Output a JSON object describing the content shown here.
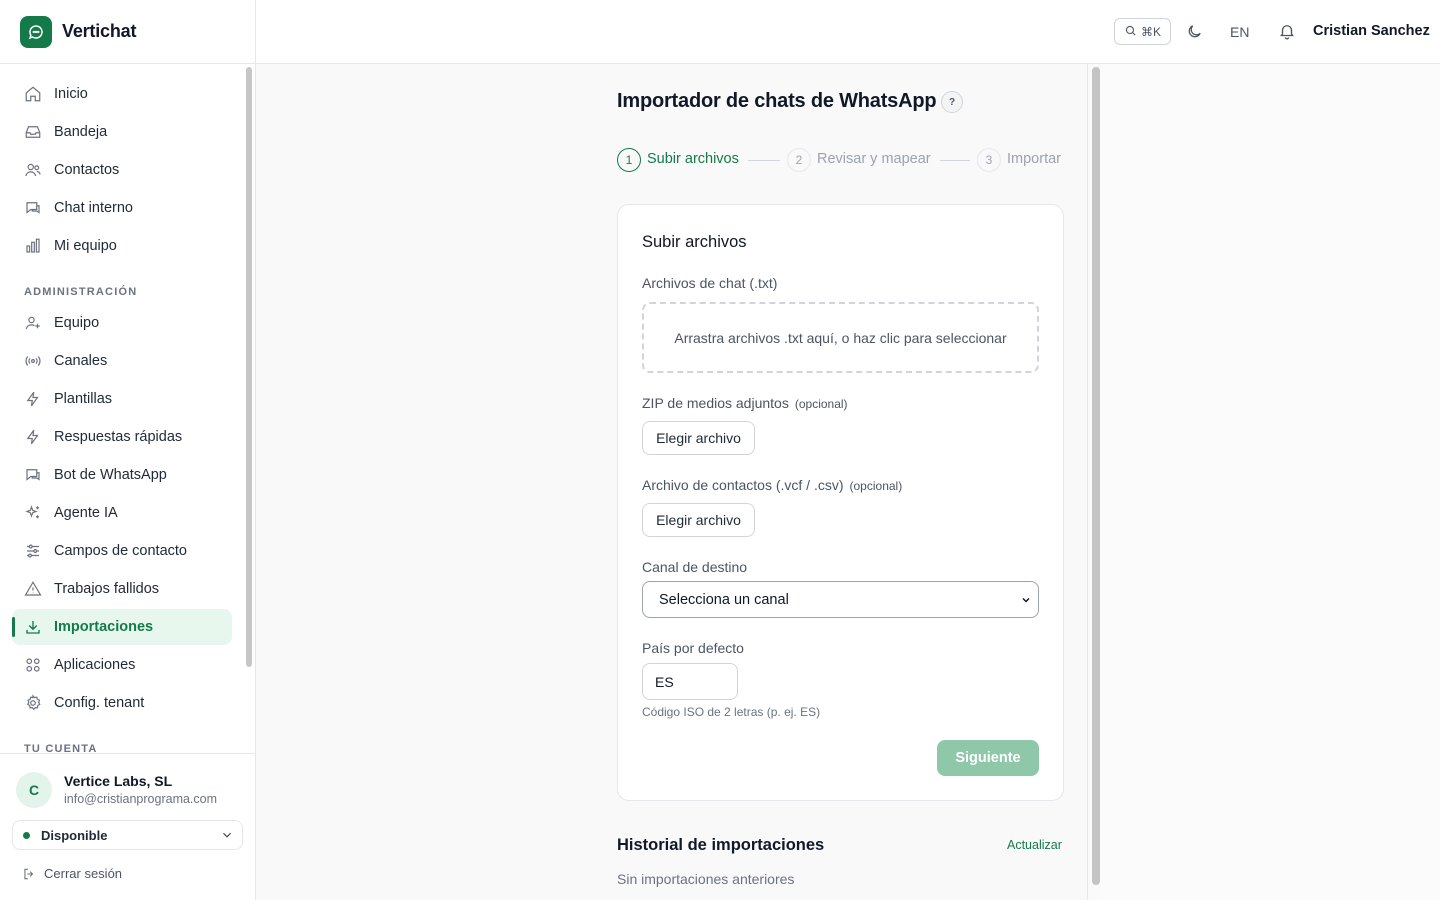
{
  "app": {
    "name": "Vertichat"
  },
  "colors": {
    "accent": "#157a4a",
    "accent_light": "#e8f7ee",
    "disabled_button": "#8fc7a9"
  },
  "topbar": {
    "search_shortcut": "⌘K",
    "language": "EN",
    "user_name": "Cristian Sanchez"
  },
  "sidebar": {
    "items": [
      {
        "label": "Inicio",
        "icon": "home-icon"
      },
      {
        "label": "Bandeja",
        "icon": "inbox-icon"
      },
      {
        "label": "Contactos",
        "icon": "users-icon"
      },
      {
        "label": "Chat interno",
        "icon": "chat-icon"
      },
      {
        "label": "Mi equipo",
        "icon": "bar-chart-icon"
      }
    ],
    "admin_label": "ADMINISTRACIÓN",
    "admin_items": [
      {
        "label": "Equipo",
        "icon": "user-plus-icon"
      },
      {
        "label": "Canales",
        "icon": "radio-icon"
      },
      {
        "label": "Plantillas",
        "icon": "bolt-icon"
      },
      {
        "label": "Respuestas rápidas",
        "icon": "bolt-icon"
      },
      {
        "label": "Bot de WhatsApp",
        "icon": "chat-bot-icon"
      },
      {
        "label": "Agente IA",
        "icon": "sparkles-icon"
      },
      {
        "label": "Campos de contacto",
        "icon": "sliders-icon"
      },
      {
        "label": "Trabajos fallidos",
        "icon": "alert-triangle-icon"
      },
      {
        "label": "Importaciones",
        "icon": "download-icon",
        "active": true
      },
      {
        "label": "Aplicaciones",
        "icon": "grid-icon"
      },
      {
        "label": "Config. tenant",
        "icon": "gear-icon"
      }
    ],
    "account_label": "TU CUENTA"
  },
  "account": {
    "avatar_letter": "C",
    "name": "Vertice Labs, SL",
    "email": "info@cristianprograma.com",
    "status": "Disponible",
    "logout": "Cerrar sesión"
  },
  "page": {
    "title": "Importador de chats de WhatsApp",
    "help": "?",
    "steps": [
      {
        "num": "1",
        "label": "Subir archivos",
        "active": true
      },
      {
        "num": "2",
        "label": "Revisar y mapear",
        "active": false
      },
      {
        "num": "3",
        "label": "Importar",
        "active": false
      }
    ]
  },
  "upload_card": {
    "title": "Subir archivos",
    "chat_files_label": "Archivos de chat (.txt)",
    "dropzone_text": "Arrastra archivos .txt aquí, o haz clic para seleccionar",
    "zip_label": "ZIP de medios adjuntos",
    "optional": "(opcional)",
    "choose_file": "Elegir archivo",
    "contacts_label": "Archivo de contactos (.vcf / .csv)",
    "channel_label": "Canal de destino",
    "channel_selected": "Selecciona un canal",
    "country_label": "País por defecto",
    "country_value": "ES",
    "country_hint": "Código ISO de 2 letras (p. ej. ES)",
    "next_button": "Siguiente"
  },
  "history": {
    "title": "Historial de importaciones",
    "refresh": "Actualizar",
    "empty": "Sin importaciones anteriores"
  }
}
